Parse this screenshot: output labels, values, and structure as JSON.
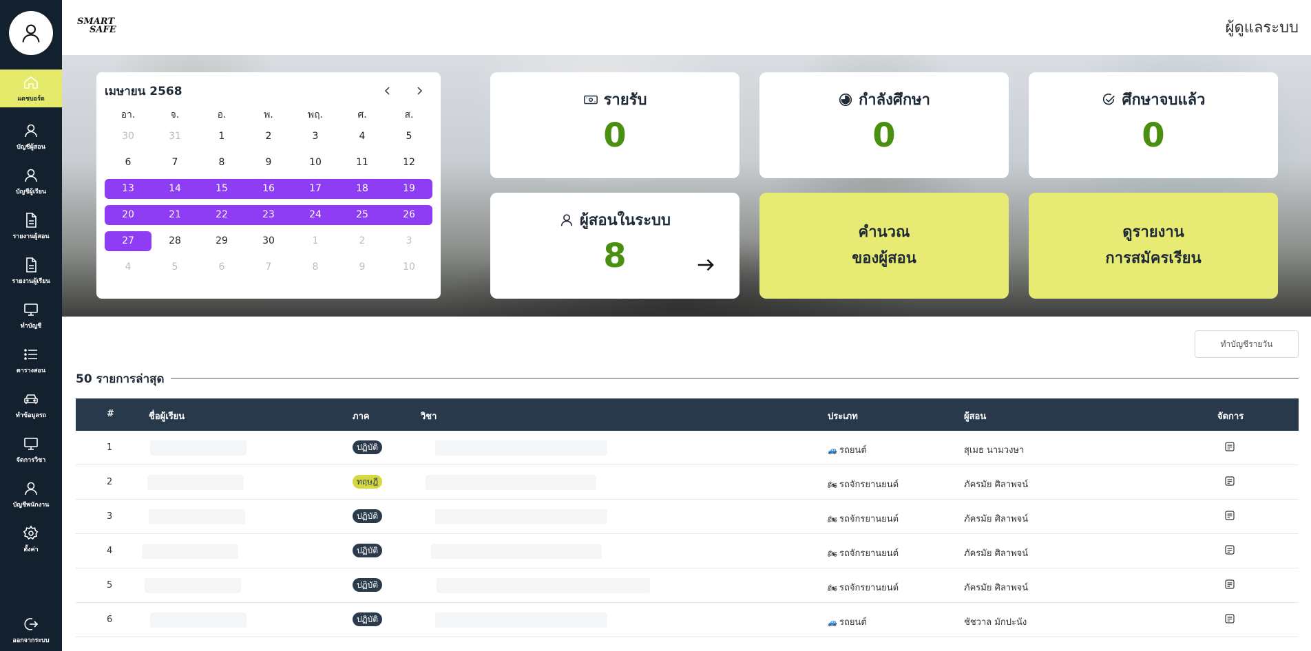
{
  "header": {
    "logo_line1": "SMART",
    "logo_line2": "SAFE",
    "role": "ผู้ดูแลระบบ"
  },
  "sidebar": {
    "items": [
      {
        "label": "แดชบอร์ด",
        "icon": "home-icon"
      },
      {
        "label": "บัญชีผู้สอน",
        "icon": "user-icon"
      },
      {
        "label": "บัญชีผู้เรียน",
        "icon": "user-icon"
      },
      {
        "label": "รายงานผู้สอน",
        "icon": "document-icon"
      },
      {
        "label": "รายงานผู้เรียน",
        "icon": "document-icon"
      },
      {
        "label": "ทำบัญชี",
        "icon": "monitor-icon"
      },
      {
        "label": "ตารางสอน",
        "icon": "list-icon"
      },
      {
        "label": "ทำข้อมูลรถ",
        "icon": "car-icon"
      },
      {
        "label": "จัดการวิชา",
        "icon": "monitor-icon"
      },
      {
        "label": "บัญชีพนักงาน",
        "icon": "user-icon"
      },
      {
        "label": "ตั้งค่า",
        "icon": "gear-icon"
      }
    ],
    "logout_label": "ออกจากระบบ"
  },
  "calendar": {
    "title": "เมษายน 2568",
    "weekdays": [
      "อา.",
      "จ.",
      "อ.",
      "พ.",
      "พฤ.",
      "ศ.",
      "ส."
    ]
  },
  "cards": {
    "income": {
      "title": "รายรับ",
      "value": "0"
    },
    "studying": {
      "title": "กำลังศึกษา",
      "value": "0"
    },
    "graduated": {
      "title": "ศึกษาจบแล้ว",
      "value": "0"
    },
    "instructors": {
      "title": "ผู้สอนในระบบ",
      "value": "8"
    },
    "calc": {
      "line1": "คำนวณ",
      "line2": "ของผู้สอน"
    },
    "report": {
      "line1": "ดูรายงาน",
      "line2": "การสมัครเรียน"
    }
  },
  "daily_button": "ทำบัญชีรายวัน",
  "recent": {
    "title": "50 รายการล่าสุด"
  },
  "table": {
    "headers": {
      "num": "#",
      "name": "ชื่อผู้เรียน",
      "part": "ภาค",
      "subject": "วิชา",
      "type": "ประเภท",
      "teacher": "ผู้สอน",
      "manage": "จัดการ"
    },
    "rows": [
      {
        "num": "1",
        "part": "ปฏิบัติ",
        "type": "รถยนต์",
        "teacher": "สุเมธ นามวงษา"
      },
      {
        "num": "2",
        "part": "ทฤษฎี",
        "type": "รถจักรยานยนต์",
        "teacher": "ภัครมัย ศิลาพจน์"
      },
      {
        "num": "3",
        "part": "ปฏิบัติ",
        "type": "รถจักรยานยนต์",
        "teacher": "ภัครมัย ศิลาพจน์"
      },
      {
        "num": "4",
        "part": "ปฏิบัติ",
        "type": "รถจักรยานยนต์",
        "teacher": "ภัครมัย ศิลาพจน์"
      },
      {
        "num": "5",
        "part": "ปฏิบัติ",
        "type": "รถจักรยานยนต์",
        "teacher": "ภัครมัย ศิลาพจน์"
      },
      {
        "num": "6",
        "part": "ปฏิบัติ",
        "type": "รถยนต์",
        "teacher": "ชัชวาล มักปะนัง"
      }
    ]
  },
  "colors": {
    "sidebar": "#13202e",
    "accent_yellow": "#e8eb73",
    "calendar_select": "#8f3cf5",
    "stat_value": "#4a8f10",
    "table_header": "#27394b"
  }
}
